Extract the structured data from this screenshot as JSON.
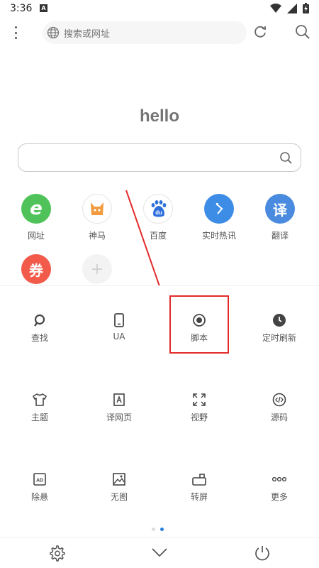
{
  "status": {
    "time": "3:36",
    "notif_letter": "A"
  },
  "search": {
    "placeholder": "搜索或网址"
  },
  "home": {
    "title": "hello"
  },
  "shortcuts": [
    {
      "label": "网址",
      "glyph": "e",
      "color": "#4fc35a"
    },
    {
      "label": "神马",
      "glyph": "",
      "color": "#ffffff"
    },
    {
      "label": "百度",
      "glyph": "du",
      "color": "#ffffff"
    },
    {
      "label": "实时热讯",
      "glyph": "",
      "color": "#3d8de6"
    },
    {
      "label": "翻译",
      "glyph": "译",
      "color": "#4a8be0"
    },
    {
      "label": "",
      "glyph": "券",
      "color": "#f25a4a"
    },
    {
      "label": "",
      "glyph": "+",
      "color": "#f3f3f3"
    }
  ],
  "tools": [
    {
      "label": "查找",
      "icon": "search-icon"
    },
    {
      "label": "UA",
      "icon": "phone-icon"
    },
    {
      "label": "脚本",
      "icon": "record-icon"
    },
    {
      "label": "定时刷新",
      "icon": "clock-icon"
    },
    {
      "label": "主题",
      "icon": "shirt-icon"
    },
    {
      "label": "译网页",
      "icon": "translate-page-icon"
    },
    {
      "label": "视野",
      "icon": "expand-icon"
    },
    {
      "label": "源码",
      "icon": "code-icon"
    },
    {
      "label": "除悬",
      "icon": "ad-block-icon"
    },
    {
      "label": "无图",
      "icon": "no-image-icon"
    },
    {
      "label": "转屏",
      "icon": "rotate-screen-icon"
    },
    {
      "label": "更多",
      "icon": "more-icon"
    }
  ],
  "annotation": {
    "color": "#e32b2b"
  },
  "pager": {
    "current": 2,
    "total": 2
  }
}
